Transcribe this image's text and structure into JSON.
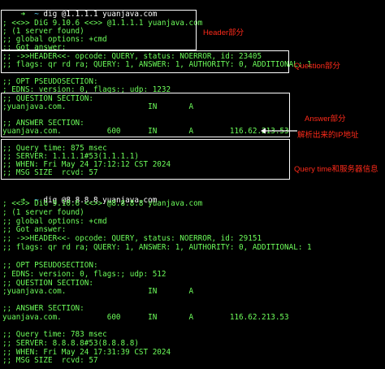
{
  "terminal": {
    "blocks": [
      {
        "prompt": {
          "arrow": "➜",
          "tilde": "~",
          "command": "dig @1.1.1.1 yuanjava.com"
        },
        "lines": [
          "; <<>> DiG 9.10.6 <<>> @1.1.1.1 yuanjava.com",
          "; (1 server found)",
          ";; global options: +cmd",
          ";; Got answer:",
          ";; ->>HEADER<<- opcode: QUERY, status: NOERROR, id: 23405",
          ";; flags: qr rd ra; QUERY: 1, ANSWER: 1, AUTHORITY: 0, ADDITIONAL: 1",
          "",
          ";; OPT PSEUDOSECTION:",
          "; EDNS: version: 0, flags:; udp: 1232",
          ";; QUESTION SECTION:",
          ";yuanjava.com.                  IN       A",
          "",
          ";; ANSWER SECTION:",
          "yuanjava.com.          600      IN       A        116.62.213.53",
          "",
          ";; Query time: 875 msec",
          ";; SERVER: 1.1.1.1#53(1.1.1.1)",
          ";; WHEN: Fri May 24 17:12:12 CST 2024",
          ";; MSG SIZE  rcvd: 57"
        ]
      },
      {
        "prompt": {
          "arrow": "➜",
          "tilde": "~",
          "command": "dig @8.8.8.8 yuanjava.com"
        },
        "lines": [
          "; <<>> DiG 9.10.6 <<>> @8.8.8.8 yuanjava.com",
          "; (1 server found)",
          ";; global options: +cmd",
          ";; Got answer:",
          ";; ->>HEADER<<- opcode: QUERY, status: NOERROR, id: 29151",
          ";; flags: qr rd ra; QUERY: 1, ANSWER: 1, AUTHORITY: 0, ADDITIONAL: 1",
          "",
          ";; OPT PSEUDOSECTION:",
          "; EDNS: version: 0, flags:; udp: 512",
          ";; QUESTION SECTION:",
          ";yuanjava.com.                  IN       A",
          "",
          ";; ANSWER SECTION:",
          "yuanjava.com.          600      IN       A        116.62.213.53",
          "",
          ";; Query time: 783 msec",
          ";; SERVER: 8.8.8.8#53(8.8.8.8)",
          ";; WHEN: Fri May 24 17:31:39 CST 2024",
          ";; MSG SIZE  rcvd: 57"
        ]
      }
    ]
  },
  "annotations": {
    "header": "Header部分",
    "question": "Question部分",
    "answer": "Answer部分",
    "ip": "解析出来的IP地址",
    "query_time": "Query time和服务器信息"
  },
  "colors": {
    "background": "#000000",
    "terminal_text": "#6cfc5a",
    "prompt_arrow": "#6cfc5a",
    "prompt_tilde": "#5fd7ff",
    "prompt_text": "#ffffff",
    "annotation": "#ff2a1a",
    "box_border": "#ffffff"
  }
}
